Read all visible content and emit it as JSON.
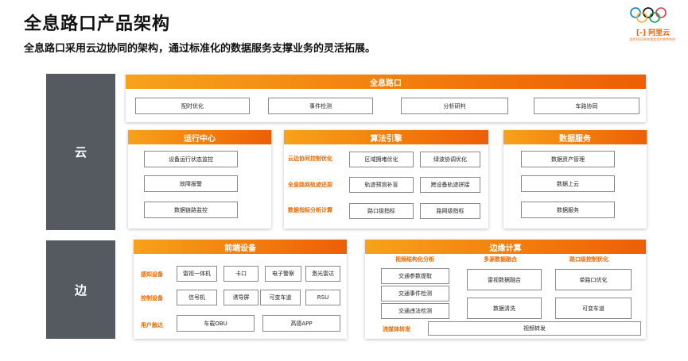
{
  "header": {
    "title": "全息路口产品架构",
    "subtitle": "全息路口采用云边协同的架构，通过标准化的数据服务支撑业务的灵活拓展。"
  },
  "logo": {
    "text": "阿里云",
    "tagline": "北京2022年冬奥会官方合作伙伴",
    "ring_colors": [
      "#0081c8",
      "#fcb131",
      "#000000",
      "#00a651",
      "#ee334e"
    ]
  },
  "colors": {
    "accent": "#f27d0c",
    "side": "#555a60",
    "label": "#ec6a00"
  },
  "cloud": {
    "label": "云",
    "holo": {
      "title": "全息路口",
      "items": [
        "配时优化",
        "事件检测",
        "分析研判",
        "车路协同"
      ]
    },
    "ops": {
      "title": "运行中心",
      "items": [
        "设备运行状态监控",
        "故障报警",
        "数据链路监控"
      ]
    },
    "algo": {
      "title": "算法引擎",
      "rows": [
        {
          "label": "云边协同控制优化",
          "items": [
            "区域拥堵优化",
            "绿波协调优化"
          ]
        },
        {
          "label": "全息路网轨迹还原",
          "items": [
            "轨迹预测补盲",
            "跨设备轨迹拼接"
          ]
        },
        {
          "label": "数据指标分析计算",
          "items": [
            "路口级指标",
            "路网级指标"
          ]
        }
      ]
    },
    "data": {
      "title": "数据服务",
      "items": [
        "数据资产管理",
        "数据上云",
        "数据服务"
      ]
    }
  },
  "edge": {
    "label": "边",
    "front": {
      "title": "前端设备",
      "rows": [
        {
          "label": "感知设备",
          "items": [
            "雷视一体机",
            "卡口",
            "电子警察",
            "激光雷达"
          ]
        },
        {
          "label": "控制设备",
          "items": [
            "信号机",
            "诱导屏",
            "可变车道",
            "RSU"
          ]
        },
        {
          "label": "用户触达",
          "items": [
            "车载OBU",
            "高德APP"
          ]
        }
      ]
    },
    "compute": {
      "title": "边缘计算",
      "col_labels": [
        "视频结构化分析",
        "多源数据融合",
        "路口级控制优化"
      ],
      "video_items": [
        "交通参数提取",
        "交通事件检测",
        "交通违法检测"
      ],
      "fusion_items": [
        "雷视数据融合",
        "数据清洗"
      ],
      "control_items": [
        "单路口优化",
        "可变车道"
      ],
      "stream_label": "流媒体转发",
      "stream_item": "视频转发"
    }
  }
}
